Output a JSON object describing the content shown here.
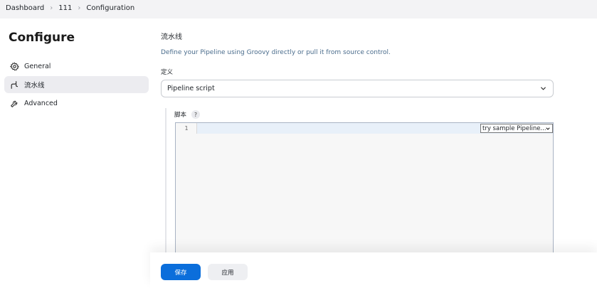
{
  "breadcrumb": [
    "Dashboard",
    "111",
    "Configuration"
  ],
  "sidebar": {
    "title": "Configure",
    "items": [
      {
        "label": "General",
        "icon": "gear-icon"
      },
      {
        "label": "流水线",
        "icon": "pipeline-icon",
        "active": true
      },
      {
        "label": "Advanced",
        "icon": "wrench-icon"
      }
    ]
  },
  "main": {
    "section_title": "流水线",
    "description": "Define your Pipeline using Groovy directly or pull it from source control.",
    "definition_label": "定义",
    "definition_value": "Pipeline script",
    "script_label": "脚本",
    "help_symbol": "?",
    "line_numbers": [
      "1"
    ],
    "sample_selector": "try sample Pipeline..."
  },
  "footer": {
    "save_label": "保存",
    "apply_label": "应用"
  },
  "colors": {
    "primary": "#0b6edb",
    "description_text": "#4a6c8c",
    "active_sidebar_bg": "#ececf0"
  }
}
